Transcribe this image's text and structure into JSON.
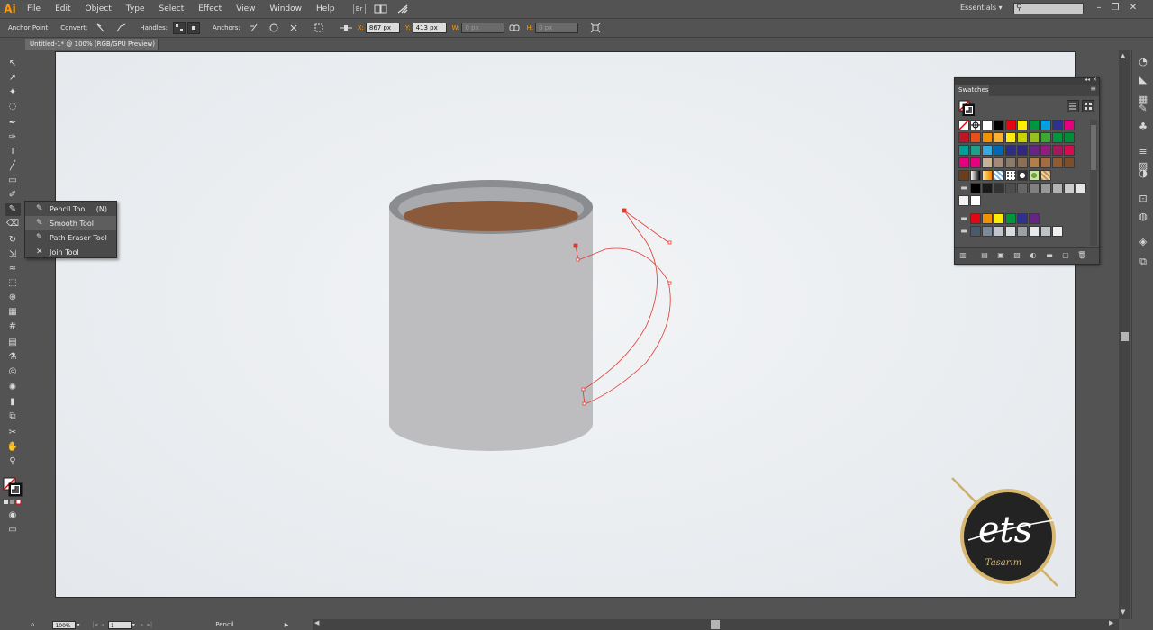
{
  "app": {
    "logo": "Ai"
  },
  "menu": [
    "File",
    "Edit",
    "Object",
    "Type",
    "Select",
    "Effect",
    "View",
    "Window",
    "Help"
  ],
  "menu_icons": {
    "bridge": "Br",
    "arrange": "arrange-documents-icon",
    "gpu": "gpu-performance-icon"
  },
  "workspace": {
    "label": "Essentials",
    "search_placeholder": ""
  },
  "control_bar": {
    "tool_label": "Anchor Point",
    "convert_label": "Convert:",
    "handles_label": "Handles:",
    "anchors_label": "Anchors:",
    "x_label": "X:",
    "x_value": "867 px",
    "y_label": "Y:",
    "y_value": "413 px",
    "w_label": "W:",
    "w_value": "0 px",
    "h_label": "H:",
    "h_value": "0 px"
  },
  "document_tab": {
    "title": "Untitled-1* @ 100% (RGB/GPU Preview)"
  },
  "tool_flyout": {
    "items": [
      {
        "label": "Pencil Tool",
        "shortcut": "(N)",
        "icon": "pencil-icon"
      },
      {
        "label": "Smooth Tool",
        "shortcut": "",
        "icon": "smooth-icon"
      },
      {
        "label": "Path Eraser Tool",
        "shortcut": "",
        "icon": "path-eraser-icon"
      },
      {
        "label": "Join Tool",
        "shortcut": "",
        "icon": "join-icon"
      }
    ]
  },
  "swatches_panel": {
    "title": "Swatches",
    "rows": [
      [
        "none",
        "registration",
        "#ffffff",
        "#000000",
        "#e30613",
        "#ffed00",
        "#009640",
        "#00a0e3",
        "#2e3192",
        "#e5007d"
      ],
      [
        "#be1622",
        "#e94e1b",
        "#f39200",
        "#f9b233",
        "#fcea10",
        "#c8d400",
        "#95c11f",
        "#3aaa35",
        "#009640",
        "#008d36"
      ],
      [
        "#00a099",
        "#1d9f8c",
        "#36a9e1",
        "#0069b4",
        "#2d2e83",
        "#312783",
        "#662483",
        "#951b81",
        "#a3195b",
        "#d60b52"
      ],
      [
        "#e6007e",
        "#e5007d",
        "#c6b299",
        "#a48a7b",
        "#8b7b6a",
        "#8a6f53",
        "#b17f4a",
        "#a76b42",
        "#8f5b32",
        "#7b4f2c"
      ],
      [
        "#6b3e1b",
        "grad-bw",
        "grad-orange",
        "grad-blue",
        "pattern-dots",
        "pattern-circle",
        "pattern-leaf",
        "pattern-brown"
      ],
      [
        "#000000",
        "#1a1a1a",
        "#333333",
        "#4d4d4d",
        "#666666",
        "#808080",
        "#999999",
        "#b3b3b3",
        "#cccccc",
        "#e6e6e6"
      ],
      [
        "#f2f2f2",
        "#ffffff"
      ],
      [
        "#e30613",
        "#f39200",
        "#ffed00",
        "#009640",
        "#2e3192",
        "#662483"
      ],
      [
        "#4a5a6a",
        "#7a8a9a",
        "#c0c6cc",
        "#d9dcdf",
        "#9aa0a6",
        "#e6e8ea",
        "#bfc3c7",
        "#f0f0f0"
      ]
    ]
  },
  "status_bar": {
    "zoom": "100%",
    "artboard": "1",
    "tool": "Pencil"
  },
  "artwork": {
    "mug_colors": {
      "body": "#bdbdbf",
      "rim": "#8b8c8f",
      "coffee": "#8b5a3b"
    },
    "path_color": "#e0382f"
  },
  "logo": {
    "script_text": "ets",
    "sub_text": "Tasarım"
  }
}
